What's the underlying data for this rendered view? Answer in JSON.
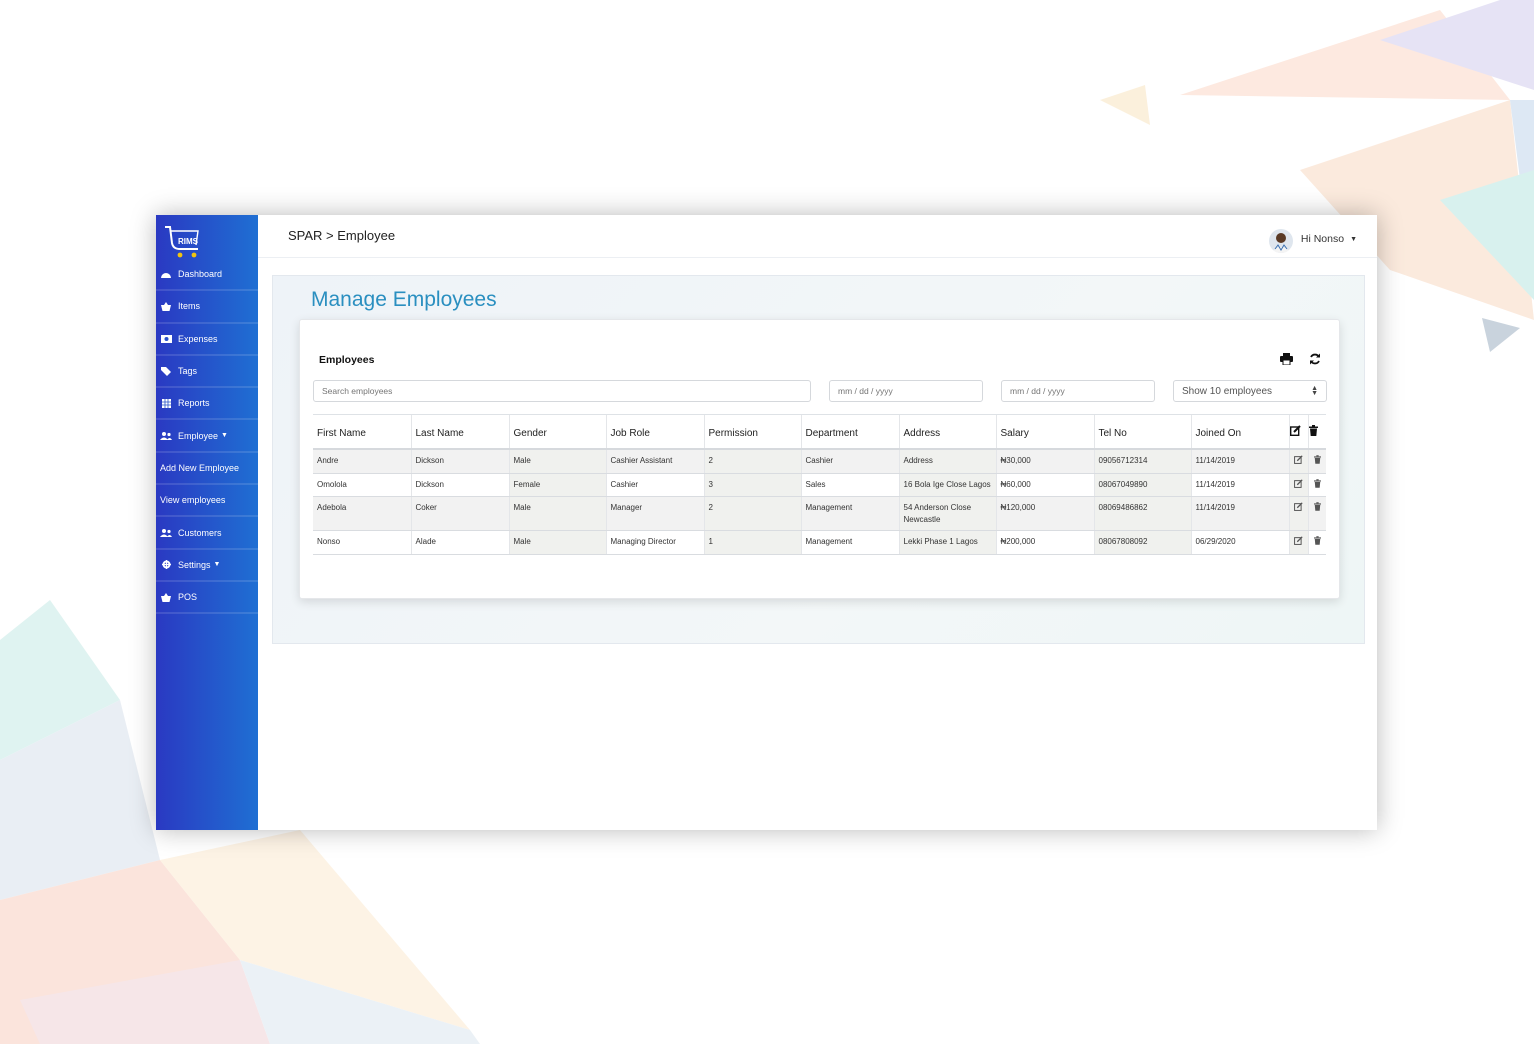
{
  "brand": {
    "logo_text": "RIMS"
  },
  "sidebar": {
    "items": [
      {
        "label": "Dashboard",
        "icon": "dashboard-icon"
      },
      {
        "label": "Items",
        "icon": "basket-icon"
      },
      {
        "label": "Expenses",
        "icon": "money-icon"
      },
      {
        "label": "Tags",
        "icon": "tags-icon"
      },
      {
        "label": "Reports",
        "icon": "grid-icon"
      },
      {
        "label": "Employee",
        "icon": "users-icon"
      },
      {
        "label": "Add New Employee"
      },
      {
        "label": "View employees"
      },
      {
        "label": "Customers",
        "icon": "users-icon"
      },
      {
        "label": "Settings",
        "icon": "gear-icon"
      },
      {
        "label": "POS",
        "icon": "basket-icon"
      }
    ]
  },
  "header": {
    "breadcrumb": "SPAR > Employee",
    "user_greeting": "Hi Nonso"
  },
  "main": {
    "title": "Manage Employees",
    "card_title": "Employees",
    "search_placeholder": "Search employees",
    "date_from_placeholder": "mm / dd / yyyy",
    "date_to_placeholder": "mm / dd / yyyy",
    "page_size_label": "Show 10 employees"
  },
  "table": {
    "columns": [
      "First Name",
      "Last Name",
      "Gender",
      "Job Role",
      "Permission",
      "Department",
      "Address",
      "Salary",
      "Tel No",
      "Joined On"
    ],
    "rows": [
      [
        "Andre",
        "Dickson",
        "Male",
        "Cashier Assistant",
        "2",
        "Cashier",
        "Address",
        "₦30,000",
        "09056712314",
        "11/14/2019"
      ],
      [
        "Omolola",
        "Dickson",
        "Female",
        "Cashier",
        "3",
        "Sales",
        "16 Bola Ige Close Lagos",
        "₦60,000",
        "08067049890",
        "11/14/2019"
      ],
      [
        "Adebola",
        "Coker",
        "Male",
        "Manager",
        "2",
        "Management",
        "54 Anderson Close Newcastle",
        "₦120,000",
        "08069486862",
        "11/14/2019"
      ],
      [
        "Nonso",
        "Alade",
        "Male",
        "Managing Director",
        "1",
        "Management",
        "Lekki Phase 1 Lagos",
        "₦200,000",
        "08067808092",
        "06/29/2020"
      ]
    ]
  },
  "colors": {
    "sidebar_start": "#2a39c2",
    "sidebar_end": "#1f6fd3",
    "title": "#2a8fc0"
  }
}
